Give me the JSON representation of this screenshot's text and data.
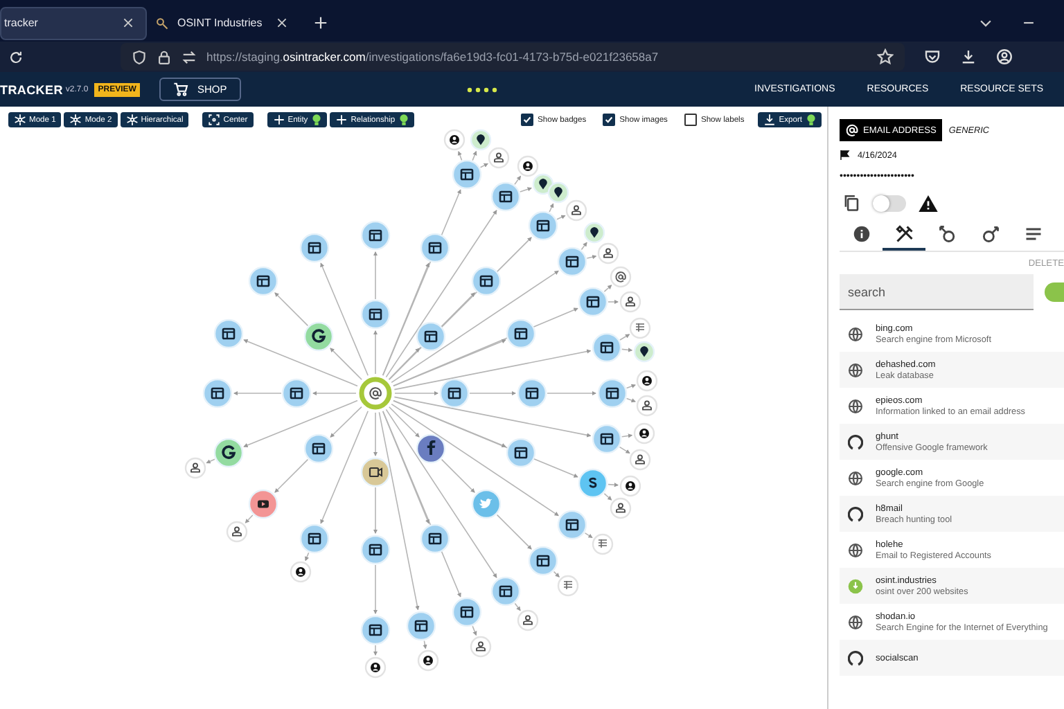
{
  "browser": {
    "tabs": [
      {
        "title": "tracker",
        "selected": true
      },
      {
        "title": "OSINT Industries",
        "selected": false
      }
    ],
    "url": {
      "prefix": "https://staging.",
      "domain": "osintracker.com",
      "path": "/investigations/fa6e19d3-fc01-4173-b75d-e021f23658a7"
    }
  },
  "app_header": {
    "brand": "TRACKER",
    "version": "v2.7.0",
    "badge": "PREVIEW",
    "shop": "SHOP",
    "nav": [
      "INVESTIGATIONS",
      "RESOURCES",
      "RESOURCE SETS"
    ]
  },
  "toolbar": {
    "buttons": [
      {
        "label": "Mode 1",
        "kind": "mode",
        "bulb": false
      },
      {
        "label": "Mode 2",
        "kind": "mode",
        "bulb": false
      },
      {
        "label": "Hierarchical",
        "kind": "mode",
        "bulb": false
      },
      {
        "label": "Center",
        "kind": "center",
        "bulb": false
      },
      {
        "label": "Entity",
        "kind": "add",
        "bulb": true
      },
      {
        "label": "Relationship",
        "kind": "add",
        "bulb": true
      }
    ],
    "checkboxes": [
      {
        "label": "Show badges",
        "checked": true
      },
      {
        "label": "Show images",
        "checked": true
      },
      {
        "label": "Show labels",
        "checked": false
      }
    ],
    "export": {
      "label": "Export",
      "bulb": true
    }
  },
  "panel": {
    "type": "EMAIL ADDRESS",
    "subtype": "GENERIC",
    "date": "4/16/2024",
    "value": "••••••••••••••••••••••",
    "toggle": {
      "on": false
    },
    "tabs": [
      {
        "kind": "info",
        "selected": false
      },
      {
        "kind": "tools",
        "selected": true
      },
      {
        "kind": "incoming",
        "selected": false
      },
      {
        "kind": "outgoing",
        "selected": false
      },
      {
        "kind": "notes",
        "selected": false
      }
    ],
    "delete": "DELETE",
    "search": {
      "placeholder": "search"
    },
    "filter_toggle": {
      "on": true
    },
    "resources": [
      {
        "name": "bing.com",
        "description": "Search engine from Microsoft",
        "kind": "web"
      },
      {
        "name": "dehashed.com",
        "description": "Leak database",
        "kind": "web"
      },
      {
        "name": "epieos.com",
        "description": "Information linked to an email address",
        "kind": "web"
      },
      {
        "name": "ghunt",
        "description": "Offensive Google framework",
        "kind": "github"
      },
      {
        "name": "google.com",
        "description": "Search engine from Google",
        "kind": "web"
      },
      {
        "name": "h8mail",
        "description": "Breach hunting tool",
        "kind": "github"
      },
      {
        "name": "holehe",
        "description": "Email to Registered Accounts",
        "kind": "web"
      },
      {
        "name": "osint.industries",
        "description": "osint over 200 websites",
        "kind": "osint"
      },
      {
        "name": "shodan.io",
        "description": "Search Engine for the Internet of Everything",
        "kind": "web"
      },
      {
        "name": "socialscan",
        "kind": "github"
      }
    ]
  }
}
